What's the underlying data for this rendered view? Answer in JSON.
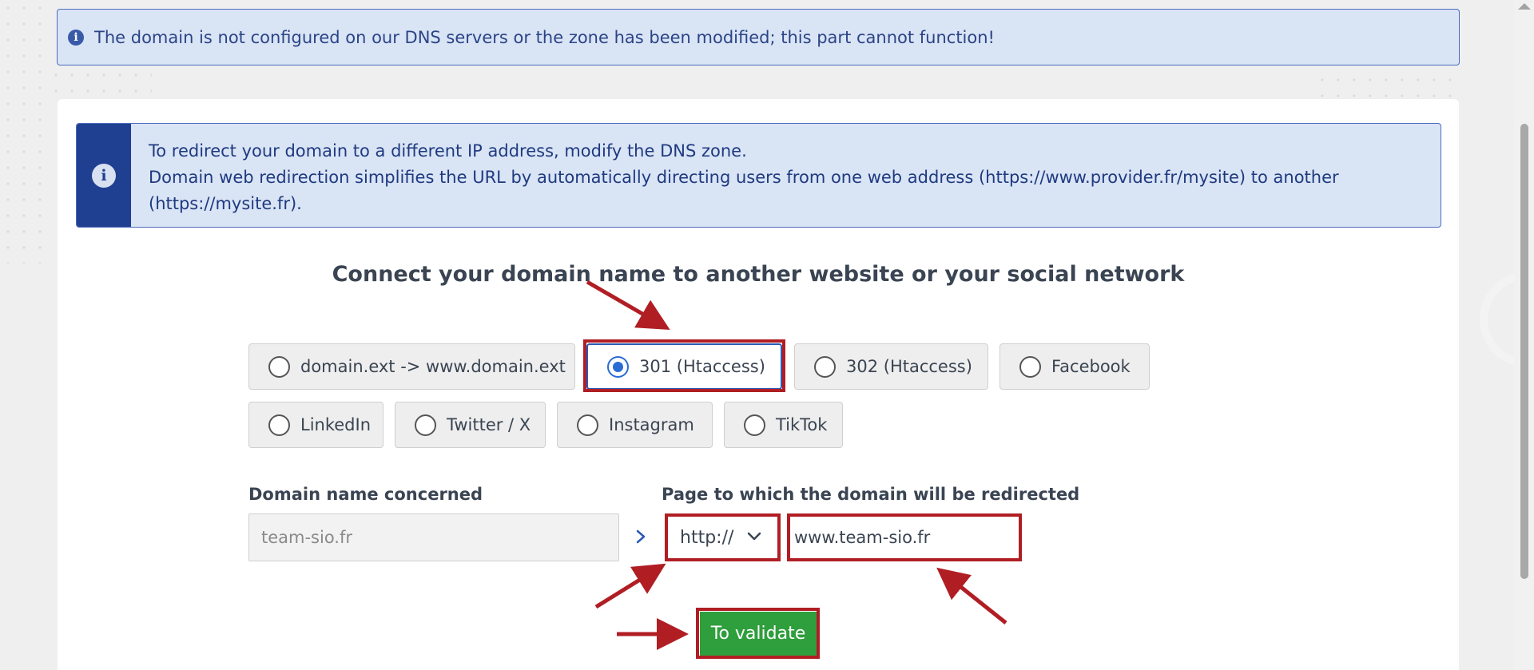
{
  "alert": {
    "text": "The domain is not configured on our DNS servers or the zone has been modified; this part cannot function!"
  },
  "info": {
    "line1": "To redirect your domain to a different IP address, modify the DNS zone.",
    "line2": "Domain web redirection simplifies the URL by automatically directing users from one web address (https://www.provider.fr/mysite) to another",
    "line3": "(https://mysite.fr)."
  },
  "heading": "Connect your domain name to another website or your social network",
  "options": [
    {
      "label": "domain.ext -> www.domain.ext",
      "selected": false
    },
    {
      "label": "301 (Htaccess)",
      "selected": true
    },
    {
      "label": "302 (Htaccess)",
      "selected": false
    },
    {
      "label": "Facebook",
      "selected": false
    },
    {
      "label": "LinkedIn",
      "selected": false
    },
    {
      "label": "Twitter / X",
      "selected": false
    },
    {
      "label": "Instagram",
      "selected": false
    },
    {
      "label": "TikTok",
      "selected": false
    }
  ],
  "form": {
    "domain_label": "Domain name concerned",
    "domain_value": "team-sio.fr",
    "target_label": "Page to which the domain will be redirected",
    "protocol_value": "http://",
    "url_value": "www.team-sio.fr",
    "validate_label": "To validate"
  },
  "colors": {
    "alert_bg": "#d9e4f5",
    "info_band": "#1f3f91",
    "validate_green": "#2f9e3c",
    "annotation_red": "#b01e24",
    "radio_selected": "#2a6bd6"
  }
}
